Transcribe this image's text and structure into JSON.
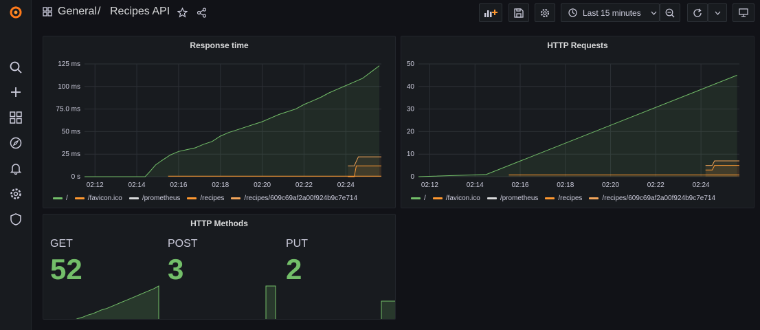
{
  "colors": {
    "green": "#73bf69",
    "orange": "#ff9830",
    "orange_dark": "#f2a55a",
    "grey": "#d8d9da"
  },
  "breadcrumb": {
    "folder": "General",
    "separator": "/",
    "dashboard": "Recipes API"
  },
  "toolbar": {
    "time_range": "Last 15 minutes"
  },
  "sidebar": {
    "items": [
      "grafana-logo-icon",
      "search-icon",
      "plus-icon",
      "dashboards-icon",
      "explore-icon",
      "alerting-icon",
      "configuration-icon",
      "shield-icon"
    ]
  },
  "panels": {
    "response_time": {
      "title": "Response time"
    },
    "http_requests": {
      "title": "HTTP Requests"
    },
    "http_methods": {
      "title": "HTTP Methods",
      "stats": [
        {
          "label": "GET",
          "value": "52"
        },
        {
          "label": "POST",
          "value": "3"
        },
        {
          "label": "PUT",
          "value": "2"
        }
      ]
    }
  },
  "legend": [
    "/",
    "/favicon.ico",
    "/prometheus",
    "/recipes",
    "/recipes/609c69af2a00f924b9c7e714"
  ],
  "chart_data": [
    {
      "type": "area",
      "title": "Response time",
      "x_ticks": [
        "02:12",
        "02:14",
        "02:16",
        "02:18",
        "02:20",
        "02:22",
        "02:24"
      ],
      "x_range": [
        11.5,
        25.7
      ],
      "y_ticks": [
        "0 s",
        "25 ms",
        "50 ms",
        "75.0 ms",
        "100 ms",
        "125 ms"
      ],
      "ylim": [
        0,
        125
      ],
      "unit": "ms",
      "series": [
        {
          "name": "/",
          "color": "#73bf69",
          "x": [
            11.5,
            14.4,
            14.6,
            14.9,
            15.2,
            15.6,
            16.0,
            16.4,
            16.8,
            17.2,
            17.6,
            18.0,
            18.4,
            18.8,
            19.2,
            19.6,
            20.0,
            20.4,
            20.8,
            21.2,
            21.6,
            22.0,
            22.4,
            22.8,
            23.2,
            23.6,
            24.0,
            24.4,
            24.8,
            25.2,
            25.6
          ],
          "values": [
            0,
            0,
            5,
            13,
            18,
            24,
            28,
            30,
            32,
            36,
            39,
            45,
            49,
            52,
            55,
            58,
            61,
            65,
            69,
            72,
            75,
            80,
            84,
            88,
            93,
            97,
            101,
            105,
            109,
            116,
            123
          ]
        },
        {
          "name": "/favicon.ico",
          "color": "#ff9830",
          "x": [
            15.5,
            25.7
          ],
          "values": [
            0.5,
            0.5
          ]
        },
        {
          "name": "/prometheus",
          "color": "#d8d9da",
          "x": [],
          "values": []
        },
        {
          "name": "/recipes",
          "color": "#ff9830",
          "x": [
            24.1,
            24.4,
            24.5,
            25.7
          ],
          "values": [
            0,
            0,
            12,
            12
          ]
        },
        {
          "name": "/recipes/609c69af2a00f924b9c7e714",
          "color": "#f2a55a",
          "x": [
            24.1,
            24.4,
            24.6,
            25.7
          ],
          "values": [
            12,
            12,
            22,
            22
          ]
        }
      ]
    },
    {
      "type": "area",
      "title": "HTTP Requests",
      "x_ticks": [
        "02:12",
        "02:14",
        "02:16",
        "02:18",
        "02:20",
        "02:22",
        "02:24"
      ],
      "x_range": [
        11.5,
        25.7
      ],
      "y_ticks": [
        "0",
        "10",
        "20",
        "30",
        "40",
        "50"
      ],
      "ylim": [
        0,
        50
      ],
      "series": [
        {
          "name": "/",
          "color": "#73bf69",
          "x": [
            11.5,
            14.5,
            25.6
          ],
          "values": [
            0,
            1,
            45
          ]
        },
        {
          "name": "/favicon.ico",
          "color": "#ff9830",
          "x": [
            15.5,
            25.7
          ],
          "values": [
            0.8,
            0.8
          ]
        },
        {
          "name": "/prometheus",
          "color": "#d8d9da",
          "x": [],
          "values": []
        },
        {
          "name": "/recipes",
          "color": "#ff9830",
          "x": [
            24.2,
            24.5,
            24.6,
            25.7
          ],
          "values": [
            3,
            3,
            5,
            5
          ]
        },
        {
          "name": "/recipes/609c69af2a00f924b9c7e714",
          "color": "#f2a55a",
          "x": [
            24.2,
            24.5,
            24.6,
            25.7
          ],
          "values": [
            5,
            5,
            7,
            7
          ]
        }
      ]
    },
    {
      "type": "area",
      "title": "HTTP Methods sparklines",
      "series": [
        {
          "name": "GET",
          "color": "#73bf69",
          "values": [
            0,
            3,
            5,
            8,
            10,
            13,
            16,
            18,
            21,
            24,
            27,
            30,
            33,
            36,
            39,
            42,
            45,
            48,
            52
          ]
        },
        {
          "name": "POST",
          "color": "#73bf69",
          "values": [
            0,
            0,
            3,
            3
          ]
        },
        {
          "name": "PUT",
          "color": "#73bf69",
          "values": [
            0,
            2
          ]
        }
      ]
    }
  ]
}
